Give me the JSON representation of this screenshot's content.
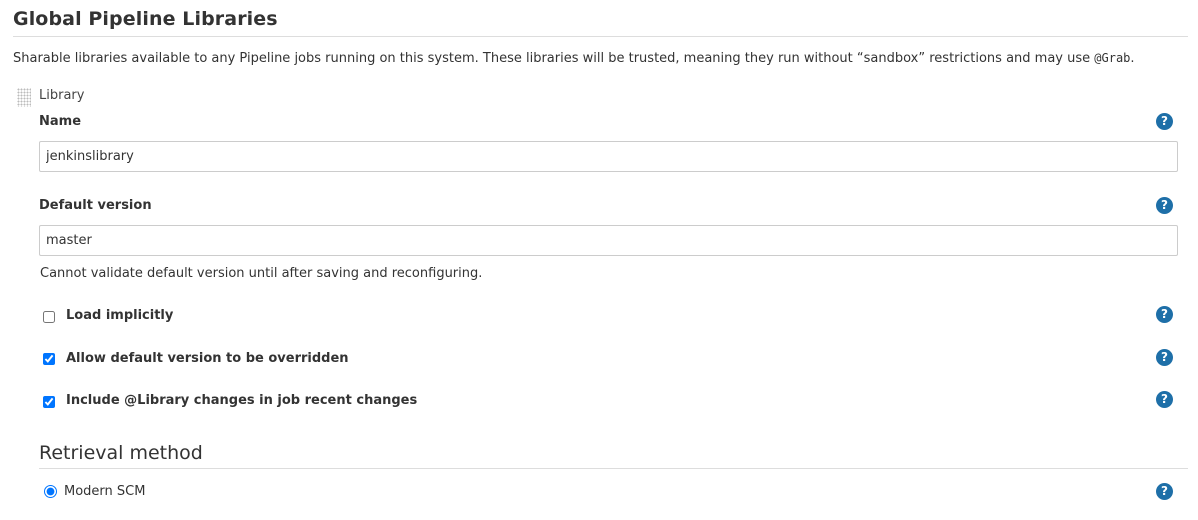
{
  "section": {
    "title": "Global Pipeline Libraries",
    "description": "Sharable libraries available to any Pipeline jobs running on this system. These libraries will be trusted, meaning they run without “sandbox” restrictions and may use ",
    "description_code": "@Grab",
    "description_end": "."
  },
  "library": {
    "label": "Library",
    "name": {
      "label": "Name",
      "value": "jenkinslibrary"
    },
    "default_version": {
      "label": "Default version",
      "value": "master",
      "note": "Cannot validate default version until after saving and reconfiguring."
    },
    "options": {
      "load_implicitly": {
        "label": "Load implicitly",
        "checked": false
      },
      "allow_override": {
        "label": "Allow default version to be overridden",
        "checked": true
      },
      "include_changes": {
        "label": "Include @Library changes in job recent changes",
        "checked": true
      }
    }
  },
  "retrieval": {
    "title": "Retrieval method",
    "modern_scm": {
      "label": "Modern SCM",
      "selected": true
    }
  },
  "help_icon": "?",
  "accent_color": "#1e6fa8"
}
